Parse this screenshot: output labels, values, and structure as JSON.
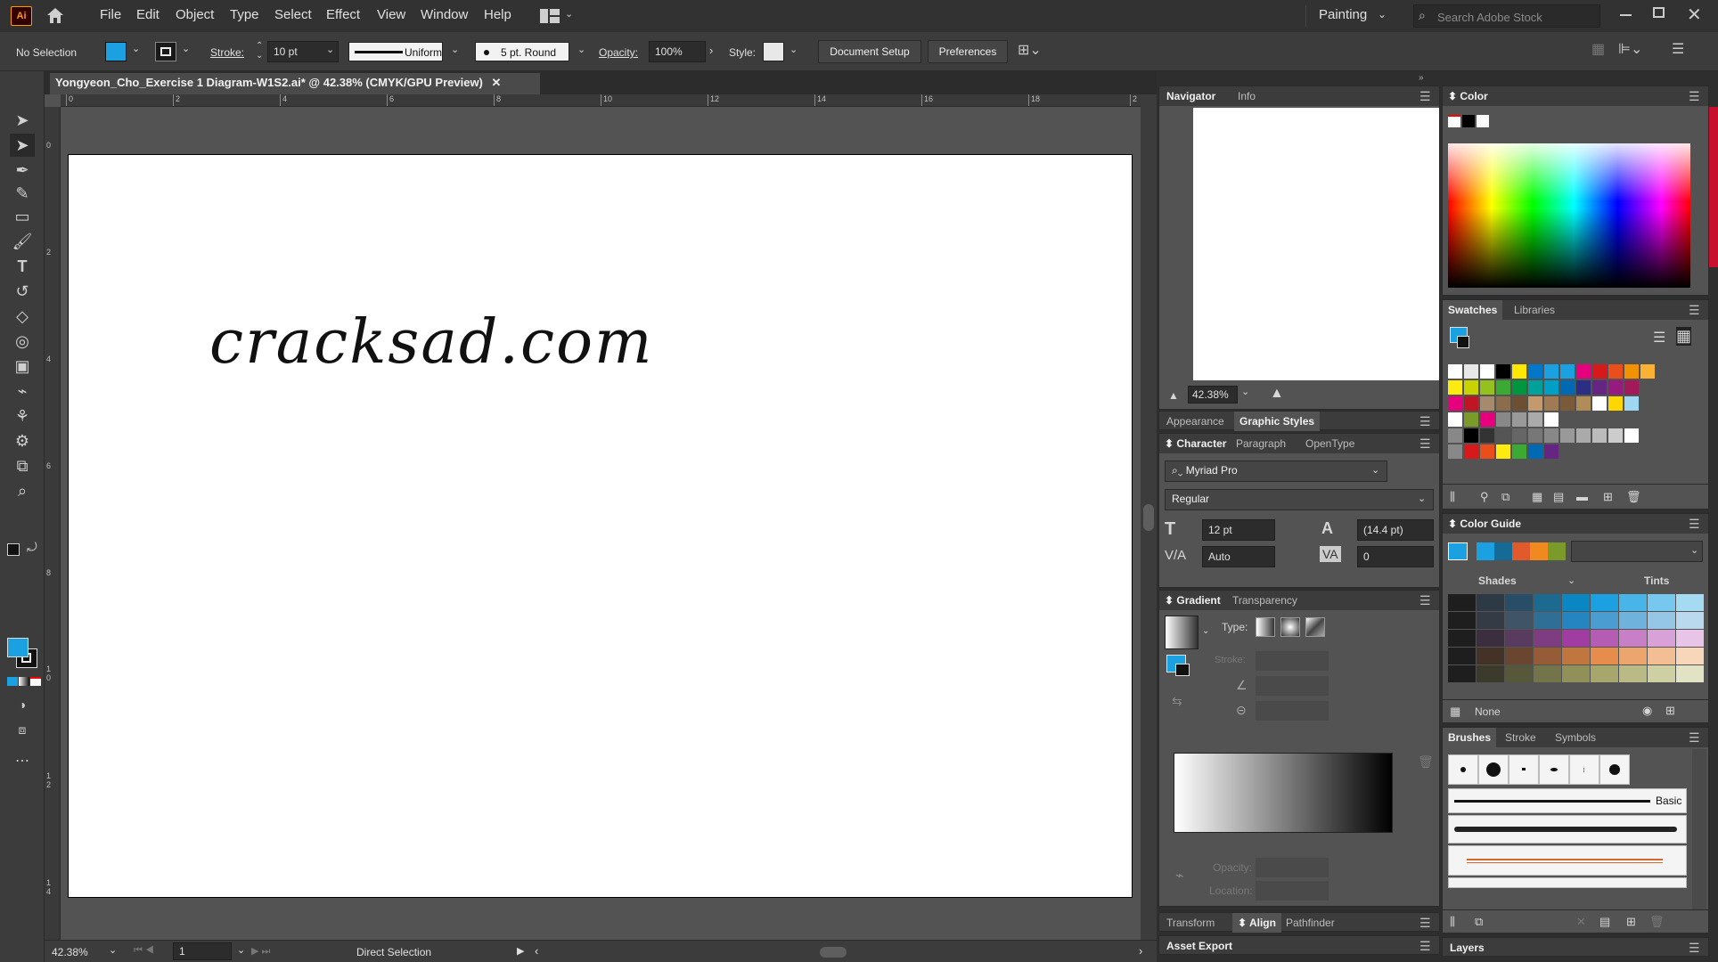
{
  "app": {
    "logo": "Ai"
  },
  "menu": [
    "File",
    "Edit",
    "Object",
    "Type",
    "Select",
    "Effect",
    "View",
    "Window",
    "Help"
  ],
  "workspace": {
    "label": "Painting",
    "search_placeholder": "Search Adobe Stock"
  },
  "control": {
    "selection": "No Selection",
    "stroke_label": "Stroke:",
    "stroke_value": "10 pt",
    "profile": "Uniform",
    "brush": "5 pt. Round",
    "opacity_label": "Opacity:",
    "opacity_value": "100%",
    "style_label": "Style:",
    "doc_setup": "Document Setup",
    "preferences": "Preferences"
  },
  "document": {
    "tab_title": "Yongyeon_Cho_Exercise 1 Diagram-W1S2.ai* @ 42.38% (CMYK/GPU Preview)",
    "artboard_text": "cracksad.com",
    "zoom": "42.38%",
    "artboard_num": "1",
    "status_tool": "Direct Selection"
  },
  "ruler_h_labels": [
    "0",
    "2",
    "4",
    "6",
    "8",
    "10",
    "12",
    "14",
    "16",
    "18",
    "2"
  ],
  "ruler_v_labels": [
    "0",
    "2",
    "4",
    "6",
    "8",
    "1\n0",
    "1\n2",
    "1\n4"
  ],
  "navigator": {
    "tab1": "Navigator",
    "tab2": "Info",
    "zoom": "42.38%"
  },
  "appearance": {
    "tab1": "Appearance",
    "tab2": "Graphic Styles"
  },
  "character": {
    "tab1": "Character",
    "tab2": "Paragraph",
    "tab3": "OpenType",
    "font": "Myriad Pro",
    "style": "Regular",
    "size": "12 pt",
    "leading": "(14.4 pt)",
    "kerning": "Auto",
    "tracking": "0"
  },
  "gradient": {
    "tab1": "Gradient",
    "tab2": "Transparency",
    "type_label": "Type:",
    "stroke_label": "Stroke:",
    "opacity_label": "Opacity:",
    "location_label": "Location:"
  },
  "bottom_tabs": {
    "transform": "Transform",
    "align": "Align",
    "pathfinder": "Pathfinder",
    "asset_export": "Asset Export"
  },
  "color": {
    "title": "Color"
  },
  "swatches": {
    "tab1": "Swatches",
    "tab2": "Libraries"
  },
  "color_guide": {
    "title": "Color Guide",
    "shades": "Shades",
    "tints": "Tints",
    "none": "None"
  },
  "brushes": {
    "tab1": "Brushes",
    "tab2": "Stroke",
    "tab3": "Symbols",
    "basic": "Basic"
  },
  "layers": {
    "title": "Layers"
  },
  "colors": {
    "accent": "#1ba1e2",
    "artboard": "#ffffff",
    "chrome": "#323232"
  }
}
